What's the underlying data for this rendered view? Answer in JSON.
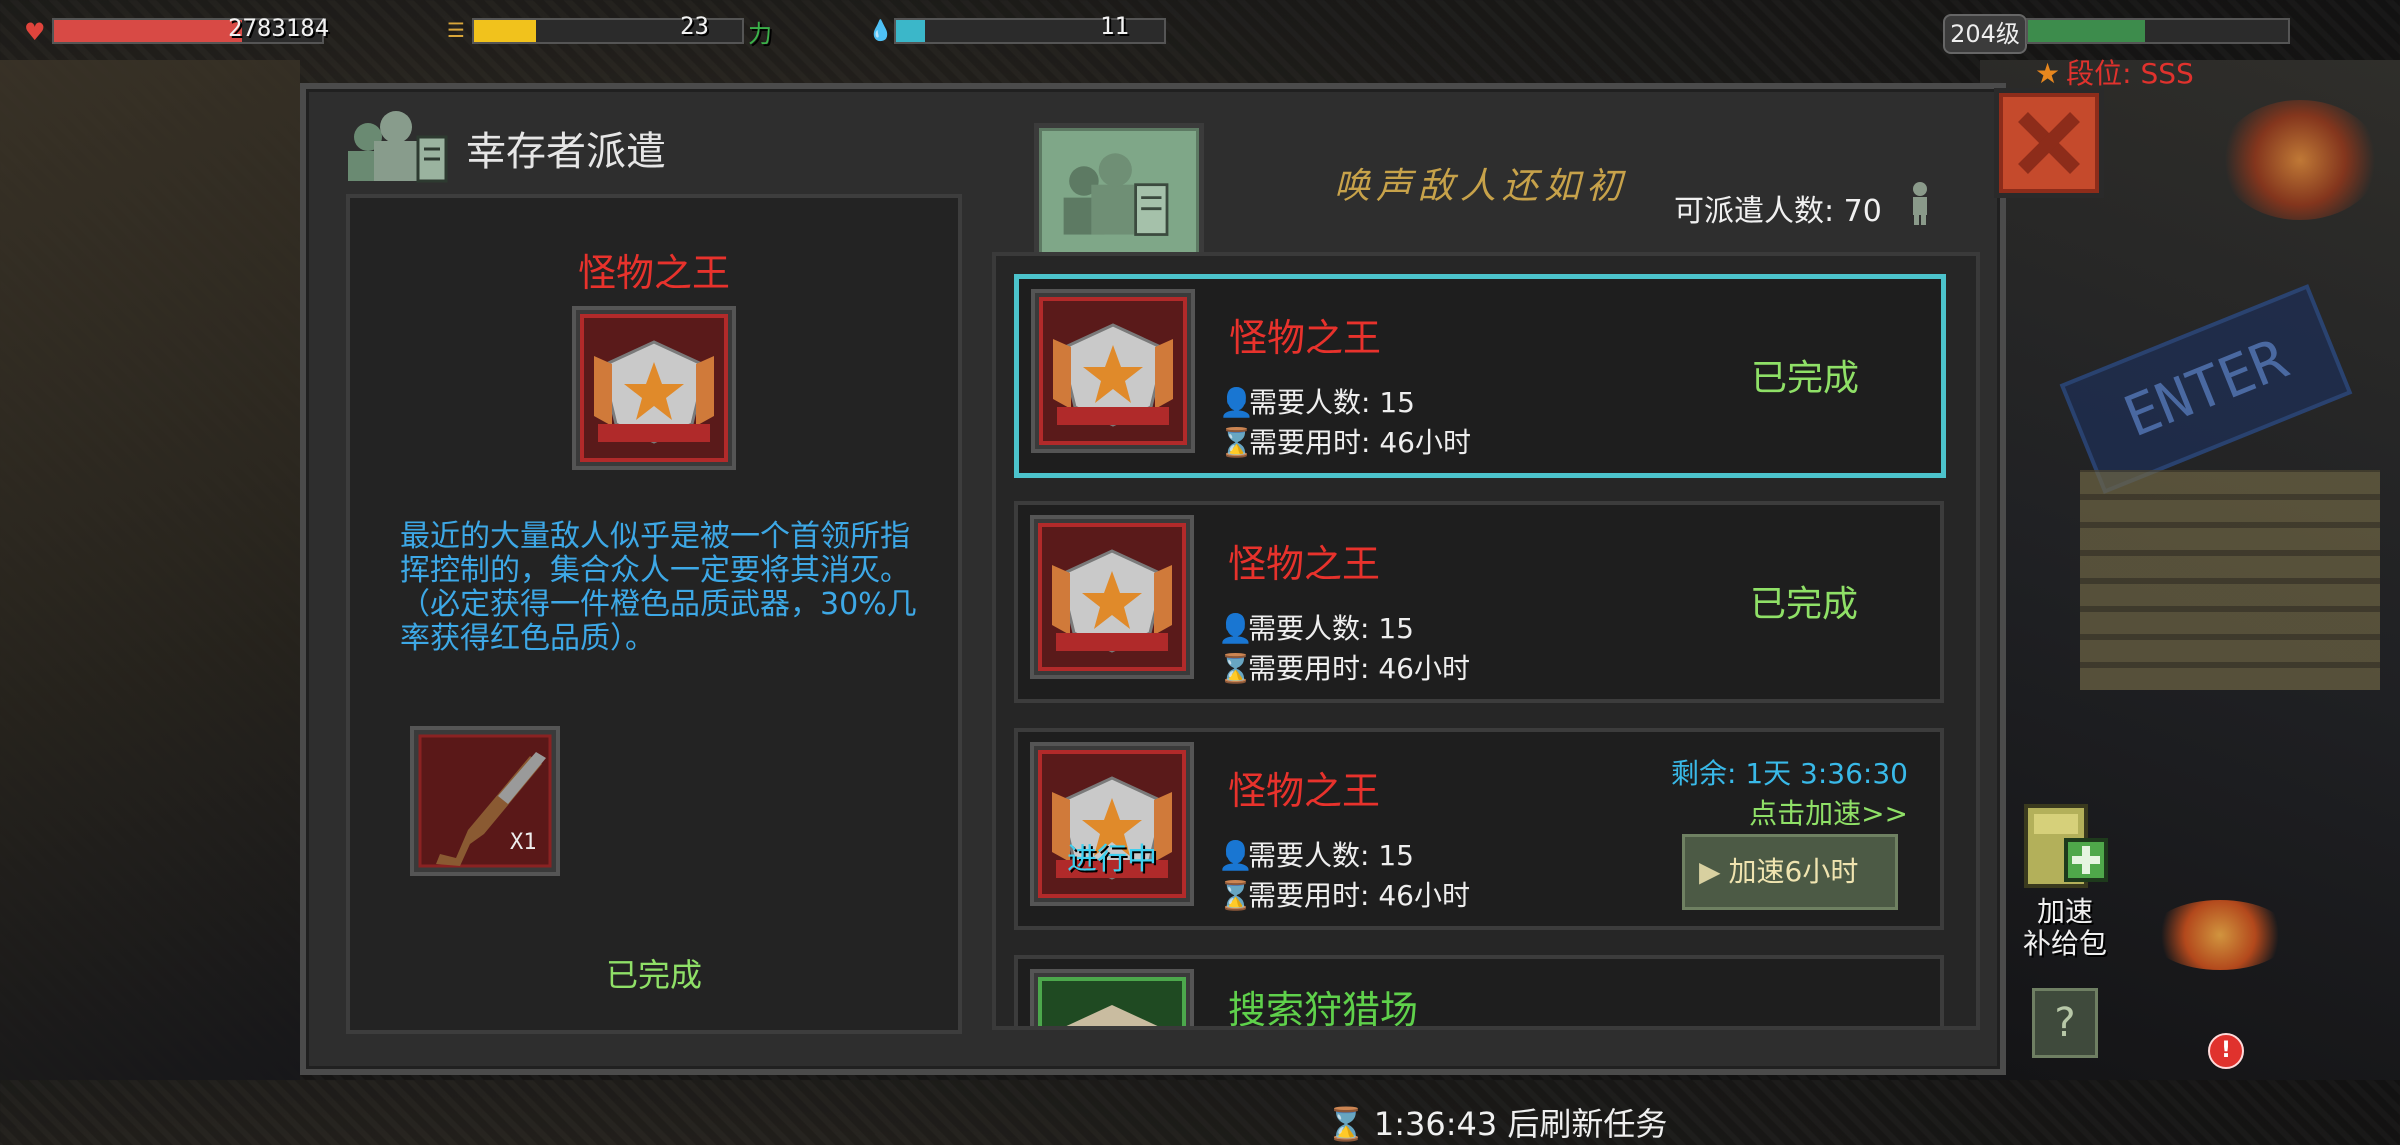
{
  "hud": {
    "health_value": "2783184",
    "health_pct": 0.7,
    "food_value": "23",
    "food_pct": 0.23,
    "food_suffix": "力",
    "water_value": "11",
    "water_pct": 0.11,
    "level": "204级",
    "level_pct": 0.45,
    "rank": "段位: SSS"
  },
  "panel": {
    "title": "幸存者派遣",
    "banner": "唤声敌人还如初",
    "dispatch_label": "可派遣人数: 70"
  },
  "detail": {
    "name": "怪物之王",
    "description": "最近的大量敌人似乎是被一个首领所指挥控制的，集合众人一定要将其消灭。（必定获得一件橙色品质武器，30%几率获得红色品质）。",
    "reward_count": "X1",
    "status": "已完成"
  },
  "tasks": [
    {
      "name": "怪物之王",
      "people": "需要人数: 15",
      "time": "需要用时: 46小时",
      "status": "已完成"
    },
    {
      "name": "怪物之王",
      "people": "需要人数: 15",
      "time": "需要用时: 46小时",
      "status": "已完成"
    },
    {
      "name": "怪物之王",
      "people": "需要人数: 15",
      "time": "需要用时: 46小时",
      "badge": "进行中",
      "remaining": "剩余: 1天 3:36:30",
      "speed_link": "点击加速>>",
      "speed_button": "加速6小时"
    },
    {
      "name": "搜索狩猎场"
    }
  ],
  "footer": {
    "refresh": "1:36:43 后刷新任务",
    "alert": "!"
  },
  "side": {
    "supply_label_1": "加速",
    "supply_label_2": "补给包",
    "help": "?"
  },
  "colors": {
    "accent_red": "#e8322c",
    "complete_green": "#8fe067",
    "info_blue": "#3da8e6",
    "selected_border": "#4cc3cc"
  },
  "icons": {
    "health": "heart-icon",
    "food": "burger-icon",
    "water": "water-drop-icon",
    "close": "close-icon",
    "person": "person-icon",
    "hourglass": "hourglass-icon",
    "emblem": "eagle-star-emblem-icon",
    "reward": "shotgun-icon",
    "supply": "supply-box-icon",
    "help": "question-icon"
  }
}
